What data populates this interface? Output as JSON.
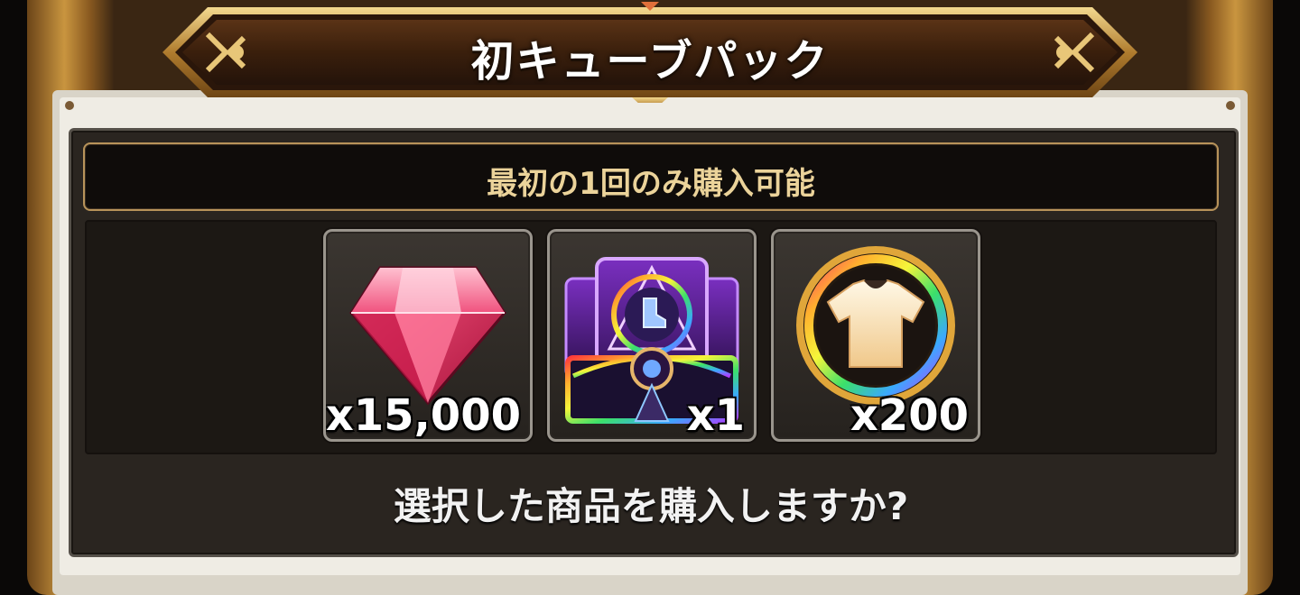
{
  "dialog": {
    "title": "初キューブパック",
    "subtitle": "最初の1回のみ購入可能",
    "question": "選択した商品を購入しますか?"
  },
  "items": [
    {
      "icon": "red-gem-icon",
      "quantity": "x15,000"
    },
    {
      "icon": "rainbow-card-chest-icon",
      "quantity": "x1"
    },
    {
      "icon": "rainbow-shirt-coin-icon",
      "quantity": "x200"
    }
  ],
  "colors": {
    "frame_gold": "#c9953f",
    "banner_brown": "#3a1f0c",
    "subtitle_text": "#ebd39a",
    "gem_red": "#e8245a"
  }
}
